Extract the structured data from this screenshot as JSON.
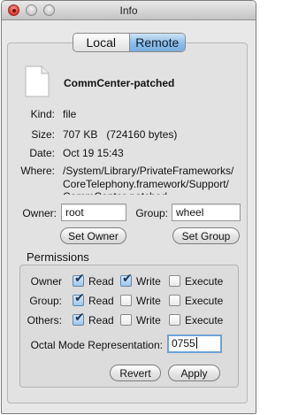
{
  "window": {
    "title": "Info"
  },
  "tabs": {
    "local": "Local",
    "remote": "Remote",
    "selected": "Remote"
  },
  "file": {
    "icon": "document-icon",
    "name": "CommCenter-patched",
    "kind_label": "Kind:",
    "kind": "file",
    "size_label": "Size:",
    "size": "707 KB   (724160 bytes)",
    "date_label": "Date:",
    "date": "Oct 19 15:43",
    "where_label": "Where:",
    "where": "/System/Library/PrivateFrameworks/ CoreTelephony.framework/Support/ CommCenter-patched"
  },
  "ownership": {
    "owner_label": "Owner:",
    "owner_value": "root",
    "group_label": "Group:",
    "group_value": "wheel",
    "set_owner": "Set Owner",
    "set_group": "Set Group"
  },
  "permissions": {
    "title": "Permissions",
    "read": "Read",
    "write": "Write",
    "execute": "Execute",
    "rows": [
      {
        "label": "Owner",
        "read": true,
        "write": true,
        "execute": false
      },
      {
        "label": "Group:",
        "read": true,
        "write": false,
        "execute": false
      },
      {
        "label": "Others:",
        "read": true,
        "write": false,
        "execute": false
      }
    ],
    "octal_label": "Octal Mode Representation:",
    "octal_value": "0755"
  },
  "actions": {
    "revert": "Revert",
    "apply": "Apply"
  }
}
